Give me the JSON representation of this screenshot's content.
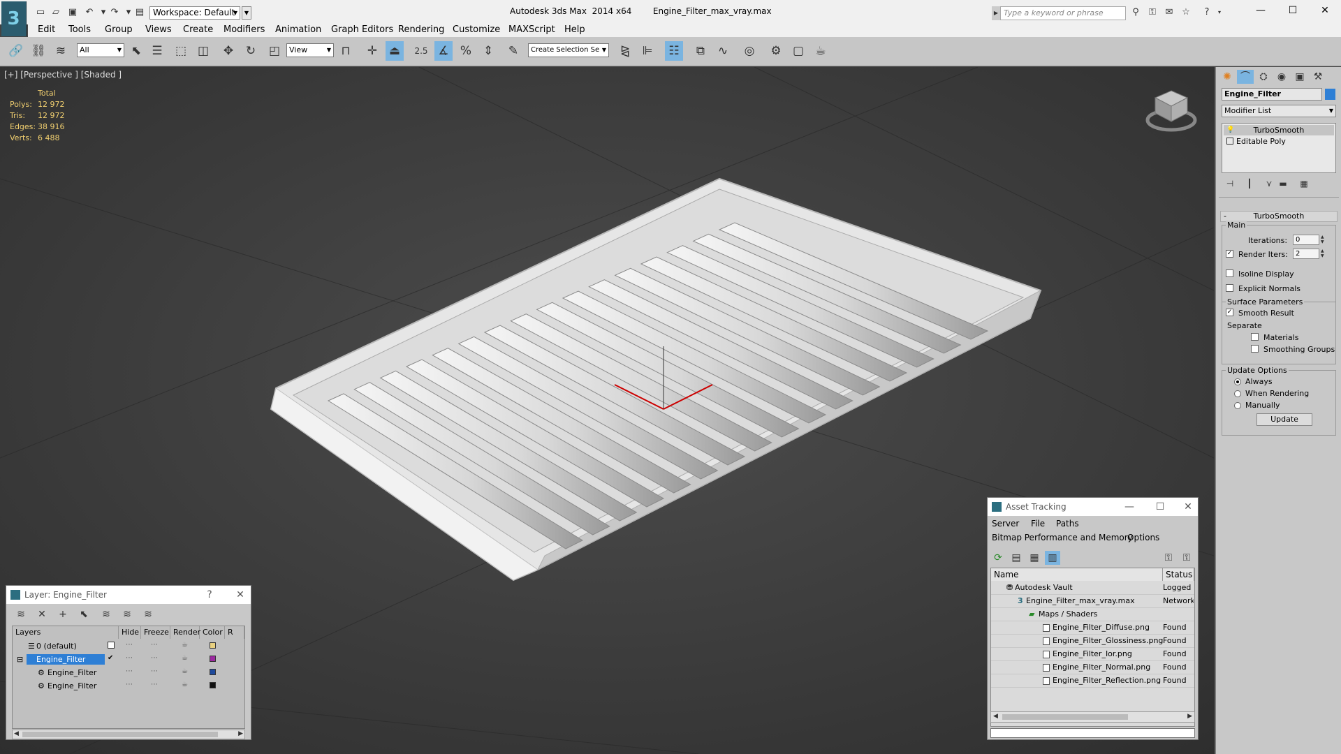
{
  "titlebar": {
    "workspace": "Workspace: Default",
    "app_title": "Autodesk 3ds Max  2014 x64",
    "file_name": "Engine_Filter_max_vray.max",
    "search_placeholder": "Type a keyword or phrase"
  },
  "menu": [
    "Edit",
    "Tools",
    "Group",
    "Views",
    "Create",
    "Modifiers",
    "Animation",
    "Graph Editors",
    "Rendering",
    "Customize",
    "MAXScript",
    "Help"
  ],
  "toolbar": {
    "selection_filter": "All",
    "ref_coord": "View",
    "named_selection": "Create Selection Se",
    "snap_angle": "2.5"
  },
  "viewport": {
    "label": "[+] [Perspective ] [Shaded ]",
    "stats_header": "Total",
    "stats": [
      {
        "label": "Polys:",
        "value": "12 972"
      },
      {
        "label": "Tris:",
        "value": "12 972"
      },
      {
        "label": "Edges:",
        "value": "38 916"
      },
      {
        "label": "Verts:",
        "value": "6 488"
      }
    ]
  },
  "command_panel": {
    "object_name": "Engine_Filter",
    "modifier_list": "Modifier List",
    "stack": [
      "TurboSmooth",
      "Editable Poly"
    ],
    "rollout_title": "TurboSmooth",
    "main_group": "Main",
    "iterations_label": "Iterations:",
    "iterations_value": "0",
    "render_iters_label": "Render Iters:",
    "render_iters_value": "2",
    "isoline_display": "Isoline Display",
    "explicit_normals": "Explicit Normals",
    "surface_group": "Surface Parameters",
    "smooth_result": "Smooth Result",
    "separate": "Separate",
    "materials": "Materials",
    "smoothing_groups": "Smoothing Groups",
    "update_group": "Update Options",
    "always": "Always",
    "when_rendering": "When Rendering",
    "manually": "Manually",
    "update_button": "Update"
  },
  "layer_window": {
    "title": "Layer: Engine_Filter",
    "help": "?",
    "columns": [
      "Layers",
      "Hide",
      "Freeze",
      "Render",
      "Color",
      "R"
    ],
    "rows": [
      {
        "name": "0 (default)",
        "color": "#e8d080"
      },
      {
        "name": "Engine_Filter",
        "color": "#9c2aa0"
      },
      {
        "name": "Engine_Filter",
        "color": "#1e4a9c"
      },
      {
        "name": "Engine_Filter",
        "color": "#111111"
      }
    ]
  },
  "asset_window": {
    "title": "Asset Tracking",
    "menu1": [
      "Server",
      "File",
      "Paths"
    ],
    "menu2": [
      "Bitmap Performance and Memory",
      "Options"
    ],
    "columns": [
      "Name",
      "Status"
    ],
    "rows": [
      {
        "name": "Autodesk Vault",
        "status": "Logged O"
      },
      {
        "name": "Engine_Filter_max_vray.max",
        "status": "Network"
      },
      {
        "name": "Maps / Shaders",
        "status": ""
      },
      {
        "name": "Engine_Filter_Diffuse.png",
        "status": "Found"
      },
      {
        "name": "Engine_Filter_Glossiness.png",
        "status": "Found"
      },
      {
        "name": "Engine_Filter_Ior.png",
        "status": "Found"
      },
      {
        "name": "Engine_Filter_Normal.png",
        "status": "Found"
      },
      {
        "name": "Engine_Filter_Reflection.png",
        "status": "Found"
      }
    ]
  },
  "colors": {
    "accent": "#2e7fd5",
    "stats_yellow": "#f2d070",
    "viewport_bg": "#454545"
  }
}
